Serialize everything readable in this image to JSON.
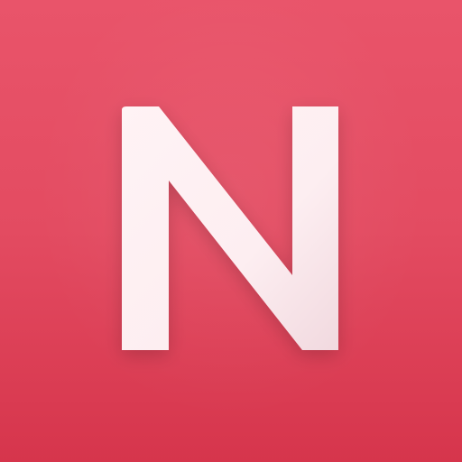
{
  "app_icon": {
    "name": "N",
    "background_color": "#e34b61",
    "background_gradient": [
      "#e9546a",
      "#d6354c"
    ],
    "letter_color": "#fff0f2",
    "letter_shade_color": "#f2dde2"
  }
}
